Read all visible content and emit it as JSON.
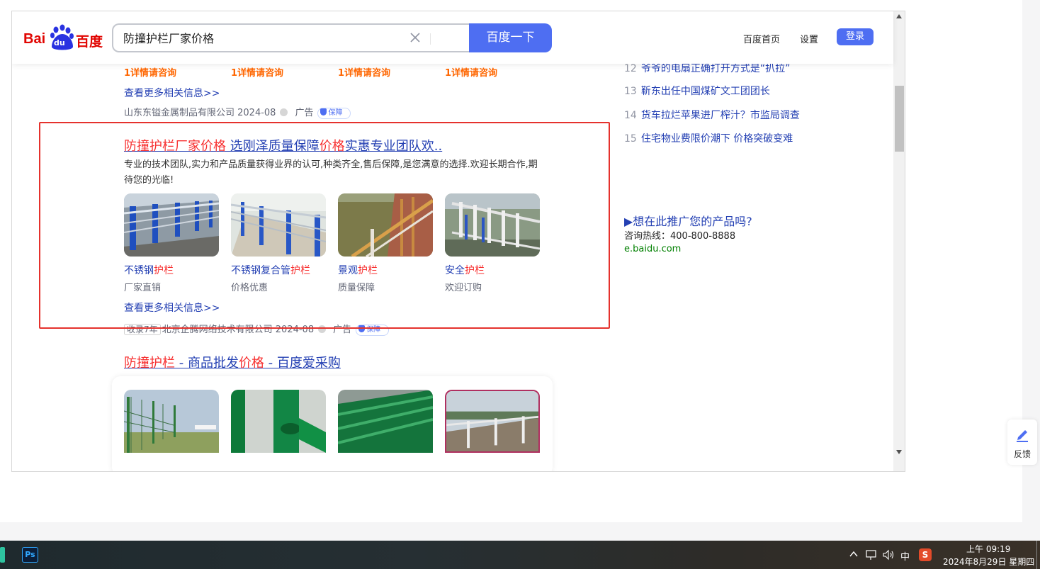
{
  "header": {
    "logo_bai": "Bai",
    "logo_du": "du",
    "logo_cn": "百度",
    "search_value": "防撞护栏厂家价格",
    "search_button": "百度一下",
    "nav": [
      "百度首页",
      "设置"
    ],
    "login": "登录"
  },
  "prev_result": {
    "orange_labels": [
      "1详情请咨询",
      "1详情请咨询",
      "1详情请咨询",
      "1详情请咨询"
    ],
    "more": "查看更多相关信息>>",
    "source": "山东东镒金属制品有限公司 2024-08",
    "ad": "广告",
    "badge": "保障"
  },
  "result1": {
    "title_parts": [
      "防撞护栏厂家价格",
      " 选刚泽质量保障",
      "价格",
      "实惠专业团队欢.."
    ],
    "desc": "专业的技术团队,实力和产品质量获得业界的认可,种类齐全,售后保障,是您满意的选择.欢迎长期合作,期待您的光临!",
    "items": [
      {
        "t1": "不锈钢",
        "t2": "护栏",
        "sub": "厂家直销"
      },
      {
        "t1": "不锈钢复合管",
        "t2": "护栏",
        "sub": "价格优惠"
      },
      {
        "t1": "景观",
        "t2": "护栏",
        "sub": "质量保障"
      },
      {
        "t1": "安全",
        "t2": "护栏",
        "sub": "欢迎订购"
      }
    ],
    "more": "查看更多相关信息>>",
    "source_tag": "收录7年",
    "source": "北京企腾网络技术有限公司 2024-08",
    "ad": "广告",
    "badge": "保障"
  },
  "result2": {
    "title_parts": [
      "防撞护栏",
      " - 商品批发",
      "价格",
      " - 百度爱采购"
    ]
  },
  "hot_list": [
    {
      "num": "12",
      "text": "爷爷的电扇正确打开方式是“扒拉”"
    },
    {
      "num": "13",
      "text": "靳东出任中国煤矿文工团团长"
    },
    {
      "num": "14",
      "text": "货车拉烂苹果进厂榨汁？市监局调查"
    },
    {
      "num": "15",
      "text": "住宅物业费限价潮下 价格突破变难"
    }
  ],
  "promo": {
    "title": "▶想在此推广您的产品吗?",
    "hotline": "咨询热线：400-800-8888",
    "url": "e.baidu.com"
  },
  "feedback": "反馈",
  "taskbar": {
    "ps": "Ps",
    "ime": "中",
    "time": "上午 09:19",
    "date": "2024年8月29日 星期四"
  },
  "colors": {
    "brand_blue": "#4e6ef2",
    "link_blue": "#2440b3",
    "highlight_red": "#f73131",
    "box_red": "#e5322d",
    "orange": "#ff6600"
  }
}
